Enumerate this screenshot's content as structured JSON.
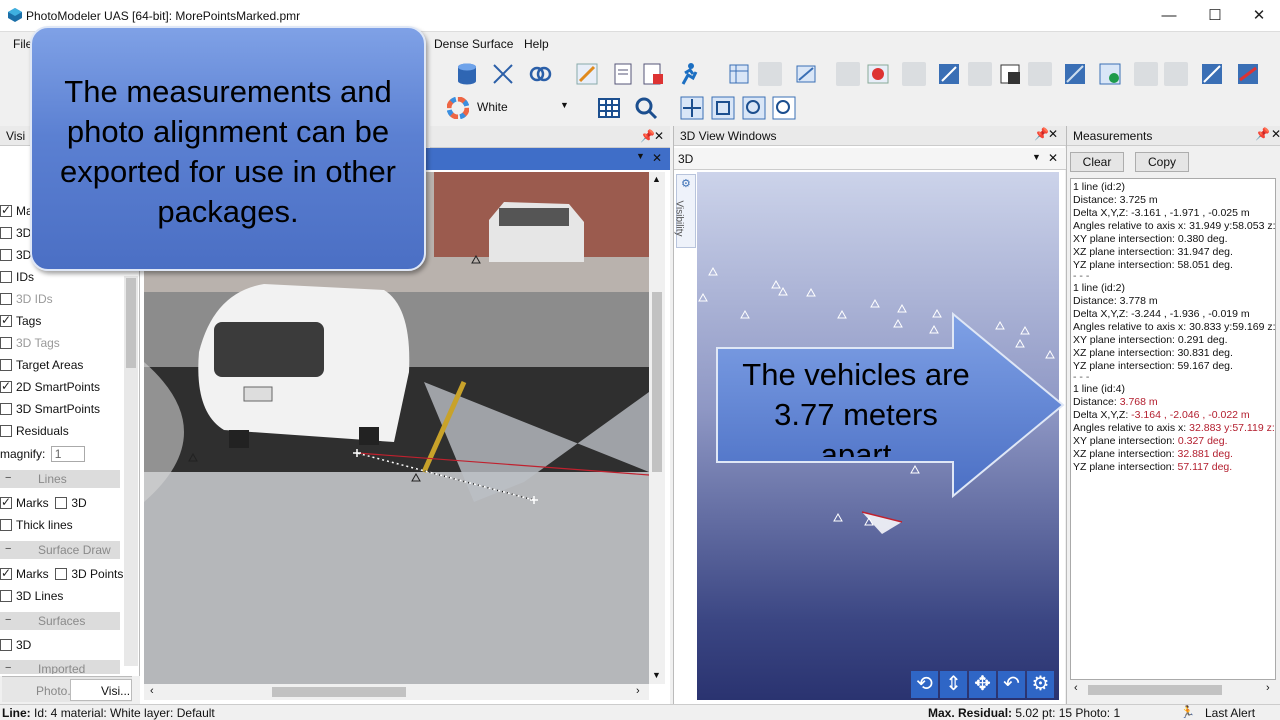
{
  "window": {
    "title": "PhotoModeler UAS [64-bit]: MorePointsMarked.pmr",
    "min": "—",
    "max": "☐",
    "close": "✕"
  },
  "menu": {
    "file": "File",
    "dense_surface": "Dense Surface",
    "help": "Help"
  },
  "toolbar": {
    "color_select": "White"
  },
  "visibility": {
    "tab_label": "Visi",
    "rows": [
      {
        "label": "Mar",
        "checked": true
      },
      {
        "label": "3D",
        "checked": false
      },
      {
        "label": "3D",
        "checked": false
      },
      {
        "label": "IDs",
        "checked": false
      },
      {
        "label": "3D IDs",
        "checked": false,
        "muted": true
      },
      {
        "label": "Tags",
        "checked": true
      },
      {
        "label": "3D Tags",
        "checked": false,
        "muted": true
      },
      {
        "label": "Target Areas",
        "checked": false
      },
      {
        "label": "2D SmartPoints",
        "checked": true
      },
      {
        "label": "3D SmartPoints",
        "checked": false
      },
      {
        "label": "Residuals",
        "checked": false
      }
    ],
    "magnify_label": "magnify:",
    "magnify_value": "1",
    "lines_group": "Lines",
    "lines_marks": "Marks",
    "lines_3d": "3D",
    "thick_lines": "Thick lines",
    "surface_draw_group": "Surface Draw",
    "sd_marks": "Marks",
    "sd_3dpoints": "3D Points",
    "sd_3dlines": "3D Lines",
    "surfaces_group": "Surfaces",
    "surf_3d": "3D",
    "imported_group": "Imported objects",
    "bottom_tab_photo": "Photo...",
    "bottom_tab_visi": "Visi..."
  },
  "view3d": {
    "panel_title": "3D View Windows",
    "tab_title": "3D",
    "side_tab": "Visibility"
  },
  "measurements": {
    "title": "Measurements",
    "clear": "Clear",
    "copy": "Copy",
    "blocks": [
      {
        "header": "1 line (id:2)",
        "distance": "Distance: 3.725 m",
        "delta": "Delta X,Y,Z: -3.161 , -1.971 , -0.025 m",
        "angles": "Angles relative to axis x: 31.949 y:58.053 z:",
        "xy": "XY plane intersection:  0.380 deg.",
        "xz": "XZ plane intersection:  31.947 deg.",
        "yz": "YZ plane intersection:  58.051 deg.",
        "sep": "- - -"
      },
      {
        "header": "1 line (id:2)",
        "distance": "Distance: 3.778 m",
        "delta": "Delta X,Y,Z: -3.244 , -1.936 , -0.019 m",
        "angles": "Angles relative to axis x: 30.833 y:59.169 z:",
        "xy": "XY plane intersection:  0.291 deg.",
        "xz": "XZ plane intersection:  30.831 deg.",
        "yz": "YZ plane intersection:  59.167 deg.",
        "sep": "- - -"
      },
      {
        "header": "1 line (id:4)",
        "distance_label": "Distance: ",
        "distance_value": "3.768 m",
        "delta_label": "Delta X,Y,Z: ",
        "delta_value": "-3.164 , -2.046 , -0.022 m",
        "angles_label": "Angles relative to axis x: ",
        "angles_value": "32.883 y:57.119 z:",
        "xy_label": "XY plane intersection:  ",
        "xy_value": "0.327 deg.",
        "xz_label": "XZ plane intersection:  ",
        "xz_value": "32.881 deg.",
        "yz_label": "YZ plane intersection:  ",
        "yz_value": "57.117 deg."
      }
    ]
  },
  "callouts": {
    "export": "The measurements and photo alignment can be exported for use in other packages.",
    "vehicles_line1": "The vehicles are",
    "vehicles_line2": "3.77 meters",
    "vehicles_line3": "apart"
  },
  "status": {
    "left_bold": "Line:",
    "left": " Id: 4 material: White layer: Default",
    "residual_bold": "Max. Residual:",
    "residual": " 5.02 pt: 15 Photo: 1",
    "alert": "Last Alert"
  },
  "colors": {
    "callout_blue": "#5b80d2",
    "measure_red": "#b31e2e",
    "scene_dark": "#2a3370"
  }
}
